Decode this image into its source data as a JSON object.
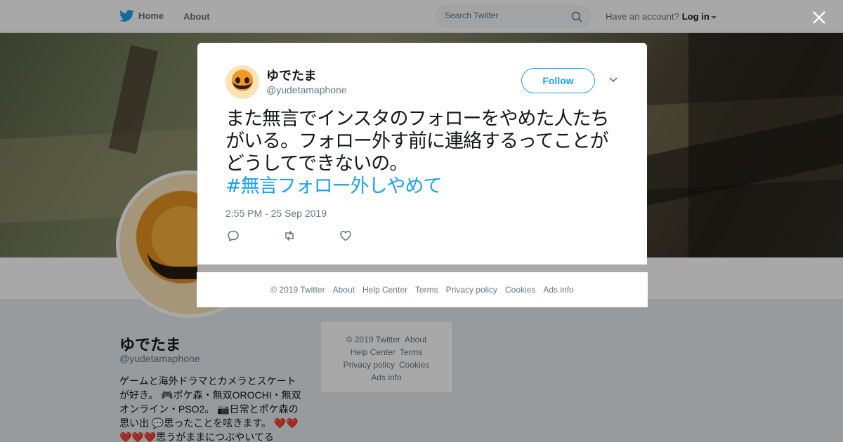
{
  "topbar": {
    "home_label": "Home",
    "about_label": "About",
    "search_placeholder": "Search Twitter",
    "account_prompt": "Have an account?",
    "login_label": "Log in"
  },
  "profile": {
    "name": "ゆでたま",
    "handle": "@yudetamaphone",
    "bio": "ゲームと海外ドラマとカメラとスケートが好き。 🎮ポケ森・無双OROCHI・無双オンライン・PSO2。 📷日常とポケ森の思い出 💬思ったことを呟きます。 ❤️❤️❤️❤️❤️思うがままにつぶやいてる"
  },
  "side_footer": {
    "copyright": "© 2019 Twitter",
    "about": "About",
    "help": "Help Center",
    "terms": "Terms",
    "privacy": "Privacy policy",
    "cookies": "Cookies",
    "ads": "Ads info"
  },
  "tweet": {
    "author_name": "ゆでたま",
    "author_handle": "@yudetamaphone",
    "follow_label": "Follow",
    "text": "また無言でインスタのフォローをやめた人たちがいる。フォロー外す前に連絡するってことがどうしてできないの。",
    "hashtag": "#無言フォロー外しやめて",
    "timestamp": "2:55 PM - 25 Sep 2019"
  },
  "modal_footer": {
    "copyright": "© 2019 Twitter",
    "about": "About",
    "help": "Help Center",
    "terms": "Terms",
    "privacy": "Privacy policy",
    "cookies": "Cookies",
    "ads": "Ads info"
  },
  "icons": {
    "logo": "twitter-bird-icon",
    "search": "search-icon",
    "close": "close-icon",
    "reply": "reply-icon",
    "retweet": "retweet-icon",
    "like": "heart-icon",
    "menu": "chevron-down-icon"
  },
  "colors": {
    "accent": "#1da1f2",
    "muted": "#657786",
    "text": "#14171a"
  }
}
